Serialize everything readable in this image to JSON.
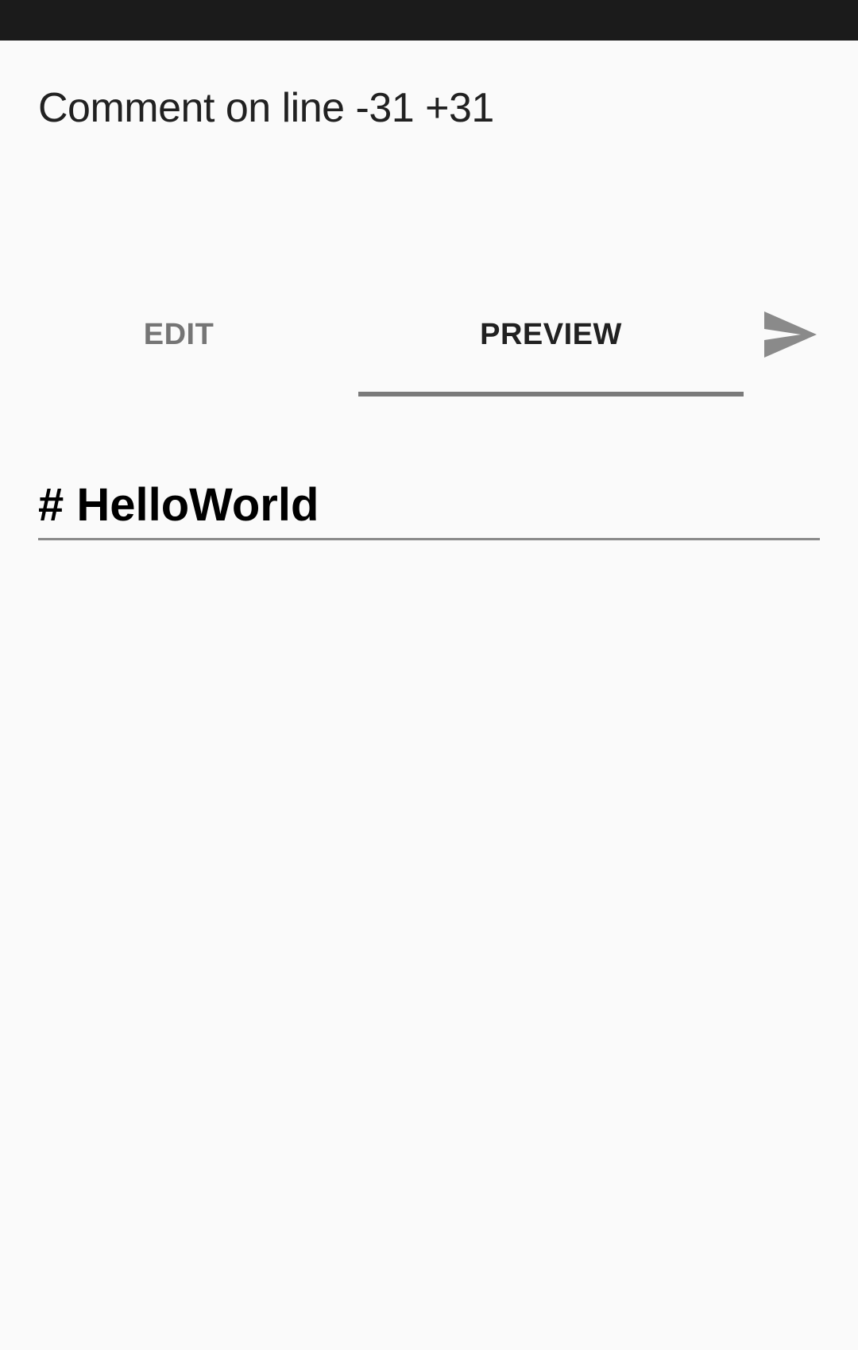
{
  "dialog": {
    "title": "Comment on line -31 +31"
  },
  "tabs": [
    {
      "label": "EDIT",
      "selected": false
    },
    {
      "label": "PREVIEW",
      "selected": true
    }
  ],
  "actions": {
    "send_icon": "send-icon"
  },
  "preview": {
    "text": "# HelloWorld"
  },
  "colors": {
    "status_bar": "#1b1b1b",
    "background": "#fafafa",
    "tab_indicator": "#7a7a7a",
    "tab_inactive": "#757575",
    "tab_active": "#212121",
    "send_icon": "#8a8a8a"
  }
}
